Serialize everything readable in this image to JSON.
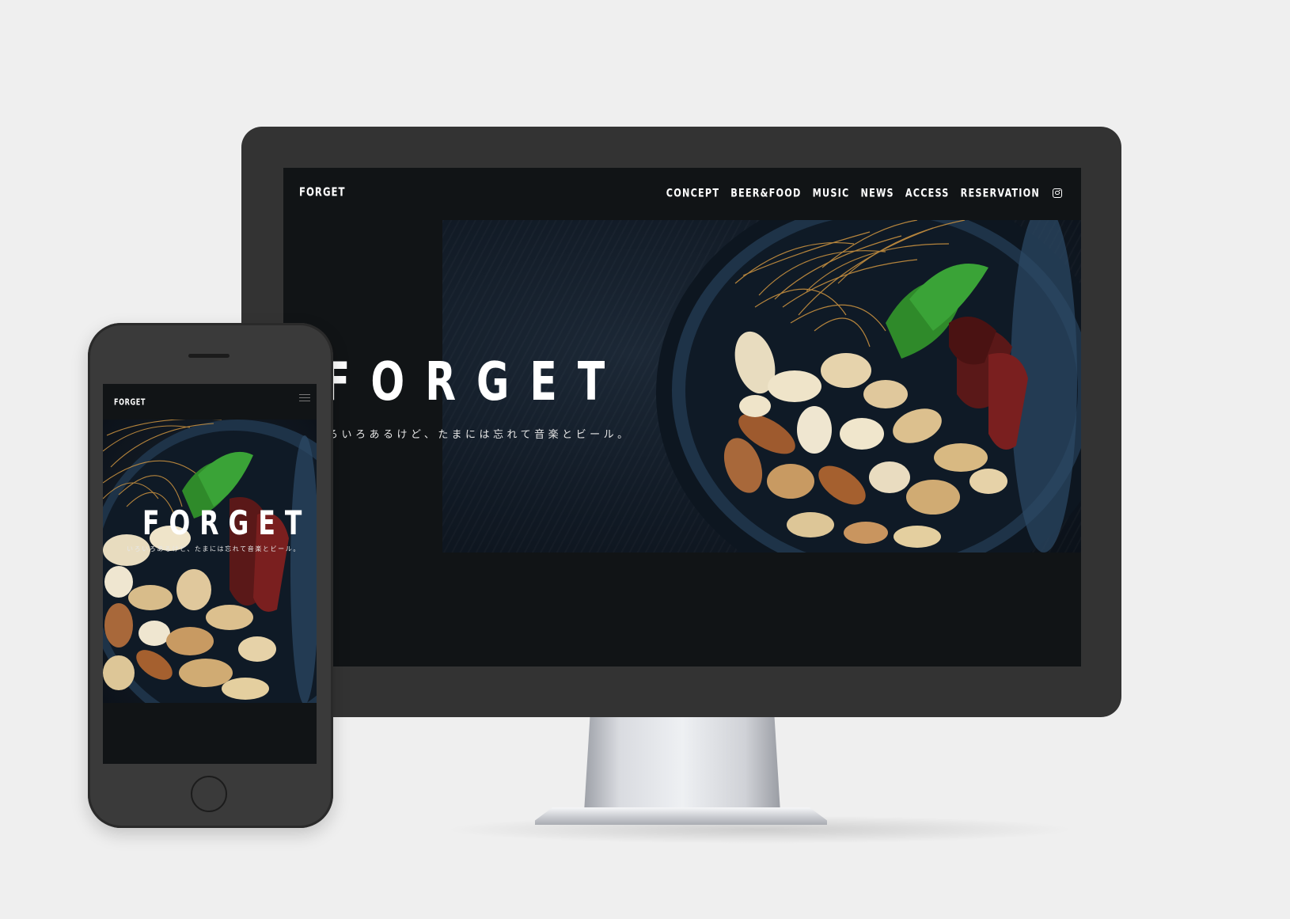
{
  "site": {
    "logo": "FORGET",
    "hero_title": "FORGET",
    "hero_subtitle": "いろいろあるけど、たまには忘れて音楽とビール。"
  },
  "desktop": {
    "hero_subtitle_visible": "ろいろあるけど、たまには忘れて音楽とビール。",
    "nav": [
      {
        "label": "CONCEPT"
      },
      {
        "label": "BEER&FOOD"
      },
      {
        "label": "MUSIC"
      },
      {
        "label": "NEWS"
      },
      {
        "label": "ACCESS"
      },
      {
        "label": "RESERVATION"
      }
    ],
    "social_icon": "instagram-icon"
  },
  "mobile": {
    "menu_icon": "hamburger-icon"
  },
  "colors": {
    "background": "#efefef",
    "device_frame": "#333333",
    "site_background": "#111416",
    "text": "#ffffff"
  }
}
